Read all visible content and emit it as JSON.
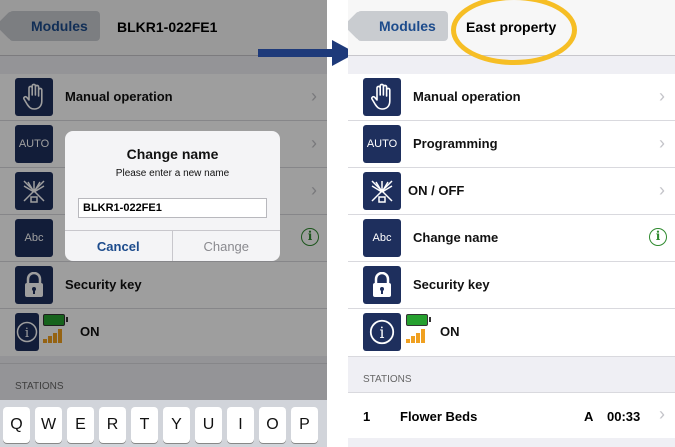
{
  "left": {
    "back_label": "Modules",
    "title": "BLKR1-022FE1",
    "rows": [
      {
        "icon": "hand-icon",
        "label": "Manual operation"
      },
      {
        "icon": "auto-icon",
        "icon_text": "AUTO"
      },
      {
        "icon": "sprinkler-icon"
      },
      {
        "icon": "abc-icon",
        "icon_text": "Abc"
      },
      {
        "icon": "lock-icon",
        "label": "Security key"
      }
    ],
    "status_label": "ON",
    "section_header": "STATIONS",
    "dialog": {
      "title": "Change name",
      "message": "Please enter a new name",
      "input_value": "BLKR1-022FE1",
      "cancel_label": "Cancel",
      "confirm_label": "Change"
    },
    "keyboard_keys": [
      "Q",
      "W",
      "E",
      "R",
      "T",
      "Y",
      "U",
      "I",
      "O",
      "P"
    ]
  },
  "right": {
    "back_label": "Modules",
    "title": "East property",
    "rows": [
      {
        "icon": "hand-icon",
        "label": "Manual operation"
      },
      {
        "icon": "auto-icon",
        "icon_text": "AUTO",
        "label": "Programming"
      },
      {
        "icon": "sprinkler-icon",
        "label": "ON / OFF"
      },
      {
        "icon": "abc-icon",
        "icon_text": "Abc",
        "label": "Change name"
      },
      {
        "icon": "lock-icon",
        "label": "Security key"
      }
    ],
    "status_label": "ON",
    "section_header": "STATIONS",
    "station": {
      "number": "1",
      "name": "Flower Beds",
      "program": "A",
      "duration": "00:33"
    }
  },
  "colors": {
    "icon_bg": "#1e2f5d",
    "accent_blue": "#1c4b8c",
    "highlight_yellow": "#f6be25",
    "arrow": "#1e3a7a",
    "battery_green": "#26a02f",
    "signal_orange": "#f0a020"
  }
}
